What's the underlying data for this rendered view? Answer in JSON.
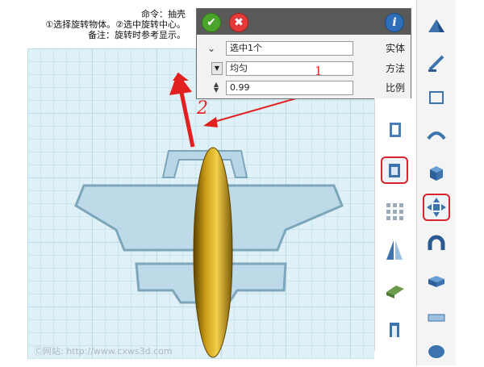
{
  "hint": {
    "line1": "命令：抽壳",
    "line2": "①选择旋转物体。②选中旋转中心。",
    "line3": "备注：旋转时参考显示。"
  },
  "panel": {
    "ok_icon": "✔",
    "cancel_icon": "✖",
    "info_icon": "i",
    "rows": [
      {
        "label": "实体",
        "value": "选中1个",
        "control": "chevron-down"
      },
      {
        "label": "方法",
        "value": "均匀",
        "control": "dropdown"
      },
      {
        "label": "比例",
        "value": "0.99",
        "control": "spinner"
      }
    ]
  },
  "annotations": {
    "one": "1",
    "two": "2"
  },
  "watermark": "Ⓒ网站: http://www.cxws3d.com",
  "colors": {
    "accent": "#d9232e",
    "fuselage": "#e0b020",
    "wing": "#b8d6e6",
    "arrow": "#e22020"
  }
}
